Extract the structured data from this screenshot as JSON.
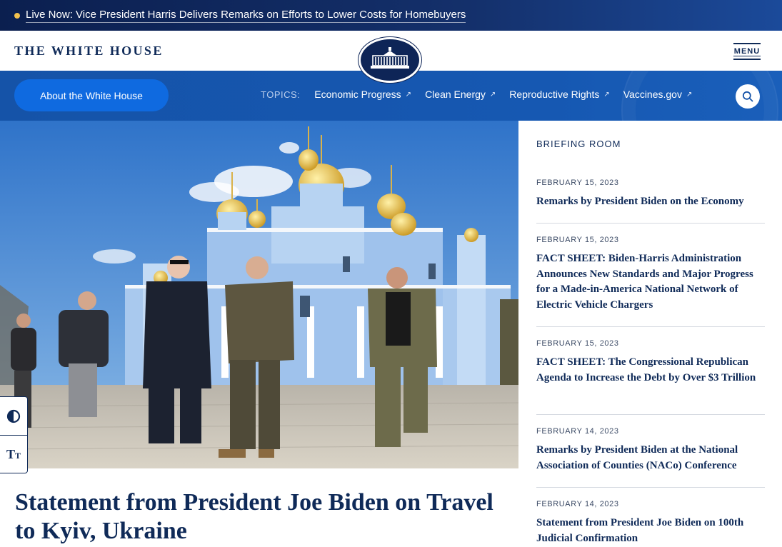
{
  "alert": {
    "text": "Live Now: Vice President Harris Delivers Remarks on Efforts to Lower Costs for Homebuyers",
    "dot_color": "#f2c14e"
  },
  "header": {
    "site_title": "THE WHITE HOUSE",
    "seal_icon": "white-house-seal-icon",
    "menu_label": "MENU"
  },
  "nav": {
    "about_label": "About the White House",
    "topics_label": "TOPICS:",
    "topics": [
      {
        "label": "Economic Progress",
        "icon": "external-arrow-icon"
      },
      {
        "label": "Clean Energy",
        "icon": "external-arrow-icon"
      },
      {
        "label": "Reproductive Rights",
        "icon": "external-arrow-icon"
      },
      {
        "label": "Vaccines.gov",
        "icon": "external-arrow-icon"
      }
    ],
    "search_icon": "search-icon"
  },
  "hero": {
    "image_alt": "",
    "headline": "Statement from President Joe Biden on Travel to Kyiv, Ukraine"
  },
  "a11y": {
    "contrast_icon": "contrast-icon",
    "text_size_icon": "text-size-icon"
  },
  "briefing": {
    "title": "BRIEFING ROOM",
    "items": [
      {
        "date": "FEBRUARY 15, 2023",
        "headline": "Remarks by President Biden on the Economy"
      },
      {
        "date": "FEBRUARY 15, 2023",
        "headline": "FACT SHEET: Biden-Harris Administration Announces New Standards and Major Progress for a Made-in-America National Network of Electric Vehicle Chargers"
      },
      {
        "date": "FEBRUARY 15, 2023",
        "headline": "FACT SHEET: The Congressional Republican Agenda to Increase the Debt by Over $3 Trillion"
      },
      {
        "date": "FEBRUARY 14, 2023",
        "headline": "Remarks by President Biden at the National Association of Counties (NACo) Conference"
      },
      {
        "date": "FEBRUARY 14, 2023",
        "headline": "Statement from President Joe Biden on 100th Judicial Confirmation"
      }
    ]
  },
  "colors": {
    "navy": "#0f2a58",
    "nav_blue": "#1553a8",
    "button_blue": "#0f6ae0"
  }
}
